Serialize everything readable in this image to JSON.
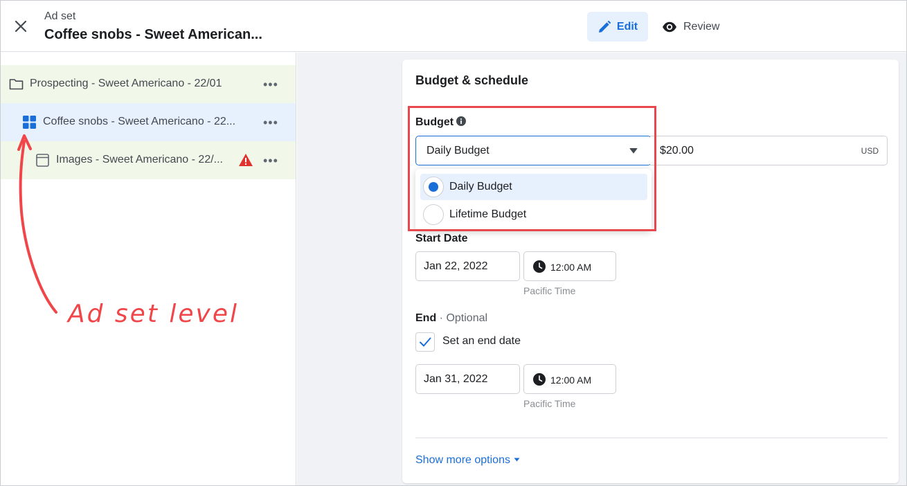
{
  "header": {
    "subtitle": "Ad set",
    "title": "Coffee snobs - Sweet American...",
    "edit_label": "Edit",
    "review_label": "Review"
  },
  "tree": {
    "items": [
      {
        "label": "Prospecting - Sweet Americano - 22/01",
        "icon": "folder-icon"
      },
      {
        "label": "Coffee snobs - Sweet Americano - 22...",
        "icon": "grid-icon"
      },
      {
        "label": "Images - Sweet Americano - 22/...",
        "icon": "ad-icon",
        "warning": true
      }
    ],
    "more_label": "•••"
  },
  "annotation": {
    "text": "Ad set level",
    "color": "#f0464a"
  },
  "budget_schedule": {
    "title": "Budget & schedule",
    "budget_label": "Budget",
    "budget_type": "Daily Budget",
    "amount": "$20.00",
    "currency": "USD",
    "options": [
      "Daily Budget",
      "Lifetime Budget"
    ],
    "selected_option": "Daily Budget",
    "start_label": "Start Date",
    "start_date": "Jan 22, 2022",
    "start_time": "12:00 AM",
    "start_tz": "Pacific Time",
    "end_label": "End",
    "end_optional": "· Optional",
    "end_checkbox_label": "Set an end date",
    "end_checked": true,
    "end_date": "Jan 31, 2022",
    "end_time": "12:00 AM",
    "end_tz": "Pacific Time",
    "show_more": "Show more options"
  },
  "colors": {
    "accent": "#1a6ed8",
    "highlight": "#e8474d"
  }
}
